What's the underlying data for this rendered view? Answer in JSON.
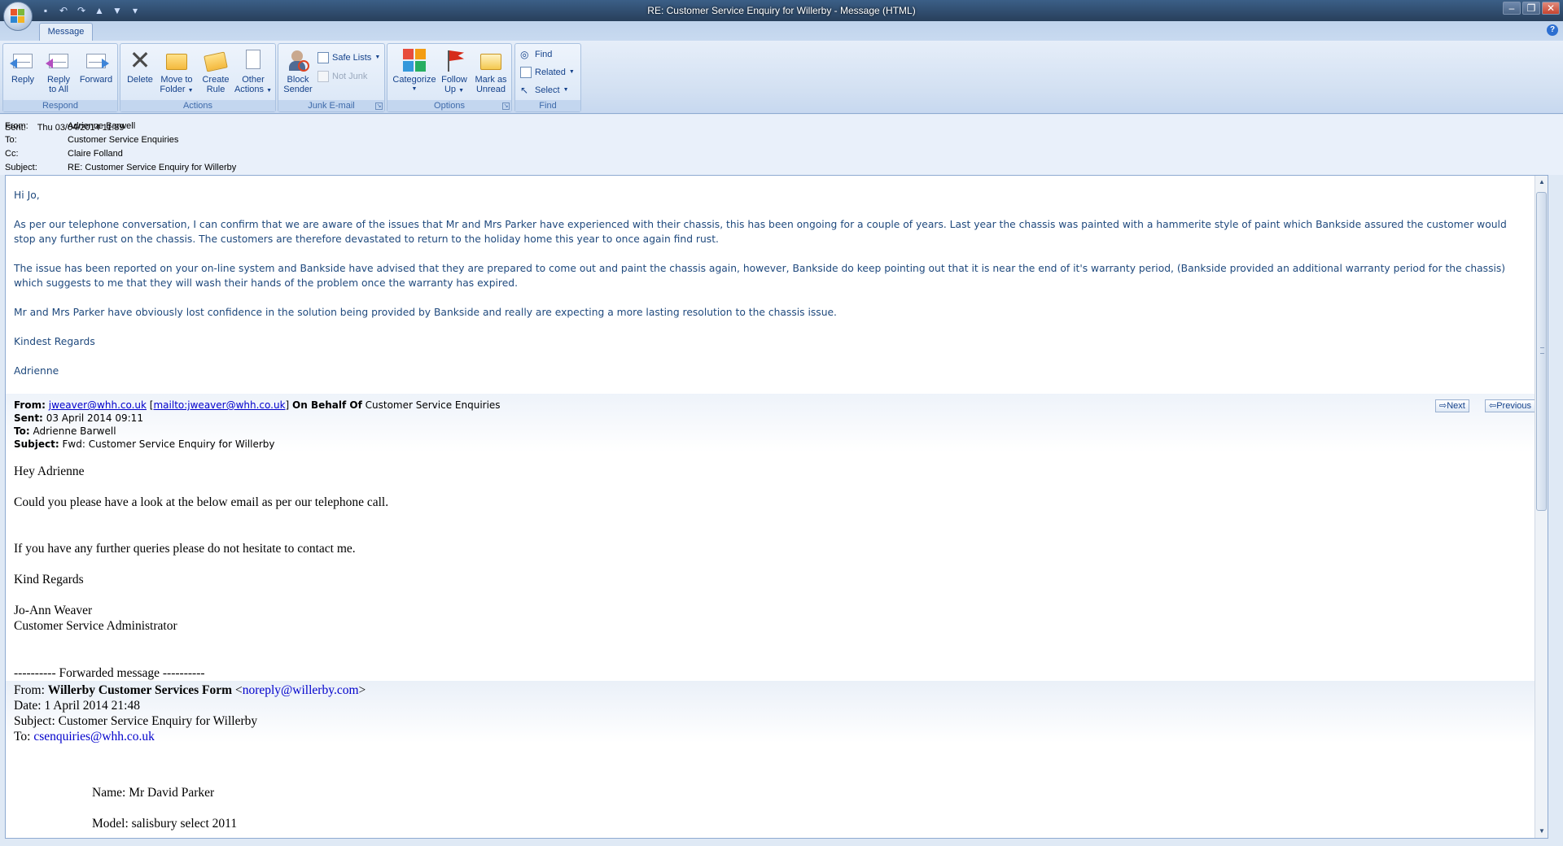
{
  "window": {
    "title": "RE: Customer Service Enquiry for Willerby - Message (HTML)",
    "controls": [
      "‒",
      "❐",
      "✕"
    ]
  },
  "ribbon": {
    "tab": "Message",
    "help": "?",
    "groups": {
      "respond": {
        "label": "Respond",
        "reply": "Reply",
        "reply_all_1": "Reply",
        "reply_all_2": "to All",
        "forward": "Forward"
      },
      "actions": {
        "label": "Actions",
        "delete": "Delete",
        "move_1": "Move to",
        "move_2": "Folder",
        "create_1": "Create",
        "create_2": "Rule",
        "other_1": "Other",
        "other_2": "Actions"
      },
      "junk": {
        "label": "Junk E-mail",
        "block_1": "Block",
        "block_2": "Sender",
        "safe_lists": "Safe Lists",
        "not_junk": "Not Junk"
      },
      "options": {
        "label": "Options",
        "categorize": "Categorize",
        "follow_1": "Follow",
        "follow_2": "Up",
        "mark_1": "Mark as",
        "mark_2": "Unread"
      },
      "find": {
        "label": "Find",
        "find": "Find",
        "related": "Related",
        "select": "Select"
      }
    }
  },
  "header": {
    "from_label": "From:",
    "from": "Adrienne Barwell",
    "to_label": "To:",
    "to": "Customer Service Enquiries",
    "cc_label": "Cc:",
    "cc": "Claire Folland",
    "subject_label": "Subject:",
    "subject": "RE: Customer Service Enquiry for Willerby",
    "sent_label": "Sent:",
    "sent": "Thu 03/04/2014 11:39"
  },
  "reply": {
    "greeting": "Hi Jo,",
    "p1": "As per our telephone conversation,  I can confirm that we are aware  of the issues that Mr and Mrs Parker have experienced with their chassis, this has been ongoing for a couple of years.  Last year the chassis was painted with a hammerite style of paint which Bankside assured the customer would stop any further rust on the chassis.  The customers are therefore devastated to return to the holiday home this year to once again find rust.",
    "p2": "The issue has been reported on your on-line system and Bankside have advised that they are prepared to come out and paint the chassis again, however,  Bankside do keep pointing out that it is near the end of it's warranty period, (Bankside provided an additional warranty period for the chassis) which suggests to me that they will wash their hands of the  problem once the warranty has expired.",
    "p3": "Mr and Mrs Parker have obviously lost confidence in the solution being provided by Bankside and really are expecting a more lasting resolution to the chassis issue.",
    "closing": "Kindest Regards",
    "signature": "Adrienne"
  },
  "forwarded": {
    "from_label": "From:",
    "from_email": "jweaver@whh.co.uk",
    "from_mailto": "mailto:jweaver@whh.co.uk",
    "behalf_label": "On Behalf Of",
    "behalf": "Customer Service Enquiries",
    "sent_label": "Sent:",
    "sent": "03 April 2014 09:11",
    "to_label": "To:",
    "to": "Adrienne Barwell",
    "subject_label": "Subject:",
    "subject": "Fwd: Customer Service Enquiry for Willerby",
    "next": "Next",
    "previous": "Previous",
    "greeting": "Hey Adrienne",
    "p1": "Could you please have a look at the below email as per our telephone call.",
    "p2": "If you have any further queries please do not hesitate to contact me.",
    "closing": "Kind Regards",
    "name": "Jo-Ann Weaver",
    "role": "Customer Service Administrator"
  },
  "original": {
    "divider": "---------- Forwarded message ----------",
    "from_label": "From:",
    "from_name": "Willerby Customer Services Form",
    "from_email": "noreply@willerby.com",
    "date": "Date: 1 April 2014 21:48",
    "subject": "Subject: Customer Service Enquiry for Willerby",
    "to_label": "To:",
    "to_email": "csenquiries@whh.co.uk",
    "name_field": "Name: Mr David Parker",
    "model_field": "Model: salisbury select 2011"
  }
}
